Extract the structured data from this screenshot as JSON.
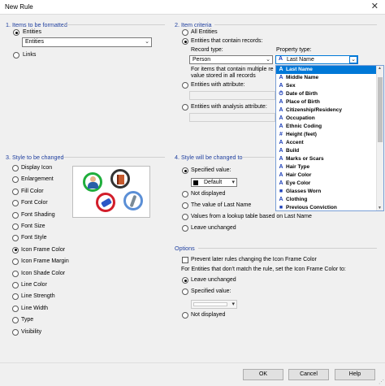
{
  "window": {
    "title": "New Rule",
    "close_glyph": "✕"
  },
  "items_group": {
    "header": "1. Items to be formatted",
    "entities_radio": "Entities",
    "entities_select": "Entities",
    "links_radio": "Links"
  },
  "criteria_group": {
    "header": "2. Item criteria",
    "all_entities": "All Entities",
    "contain_records": "Entities that contain records:",
    "record_type_label": "Record type:",
    "property_type_label": "Property type:",
    "record_type_value": "Person",
    "property_type_value": "Last Name",
    "info_line1": "For items that contain multiple re",
    "info_line2": "value stored in all records",
    "with_attribute": "Entities with attribute:",
    "with_analysis_attribute": "Entities with analysis attribute:"
  },
  "property_list": {
    "items": [
      {
        "label": "Last Name",
        "icon": "A",
        "highlighted": true
      },
      {
        "label": "Middle Name",
        "icon": "A"
      },
      {
        "label": "Sex",
        "icon": "A"
      },
      {
        "label": "Date of Birth",
        "icon": "⏱"
      },
      {
        "label": "Place of Birth",
        "icon": "A"
      },
      {
        "label": "Citizenship/Residency",
        "icon": "A"
      },
      {
        "label": "Occupation",
        "icon": "A"
      },
      {
        "label": "Ethnic Coding",
        "icon": "A"
      },
      {
        "label": "Height (feet)",
        "icon": "#"
      },
      {
        "label": "Accent",
        "icon": "A"
      },
      {
        "label": "Build",
        "icon": "A"
      },
      {
        "label": "Marks or Scars",
        "icon": "A"
      },
      {
        "label": "Hair Type",
        "icon": "A"
      },
      {
        "label": "Hair Color",
        "icon": "A"
      },
      {
        "label": "Eye Color",
        "icon": "A"
      },
      {
        "label": "Glasses Worn",
        "icon": "■"
      },
      {
        "label": "Clothing",
        "icon": "A"
      },
      {
        "label": "Previous Conviction",
        "icon": "■"
      }
    ]
  },
  "style_group": {
    "header": "3. Style to be changed",
    "options": [
      "Display Icon",
      "Enlargement",
      "Fill Color",
      "Font Color",
      "Font Shading",
      "Font Size",
      "Font Style",
      "Icon Frame Color",
      "Icon Frame Margin",
      "Icon Shade Color",
      "Line Color",
      "Line Strength",
      "Line Width",
      "Type",
      "Visibility"
    ],
    "selected_index": 7
  },
  "change_group": {
    "header": "4. Style will be changed to",
    "specified_value": "Specified value:",
    "color_value": "Default",
    "color_swatch": "#000000",
    "not_displayed": "Not displayed",
    "value_of": "The value of Last Name",
    "lookup": "Values from a lookup table based on Last Name",
    "leave_unchanged": "Leave unchanged"
  },
  "options_group": {
    "header": "Options",
    "prevent_later": "Prevent later rules changing the Icon Frame Color",
    "not_match": "For Entities that don't match the rule, set the Icon Frame Color to:",
    "leave_unchanged": "Leave unchanged",
    "specified_value": "Specified value:",
    "not_displayed": "Not displayed"
  },
  "footer": {
    "ok": "OK",
    "cancel": "Cancel",
    "help": "Help"
  },
  "colors": {
    "ring_green": "#1fae3c",
    "ring_dark": "#333333",
    "ring_red": "#d21e2b",
    "ring_blue": "#5b8fd6",
    "accent": "#0078d7"
  }
}
